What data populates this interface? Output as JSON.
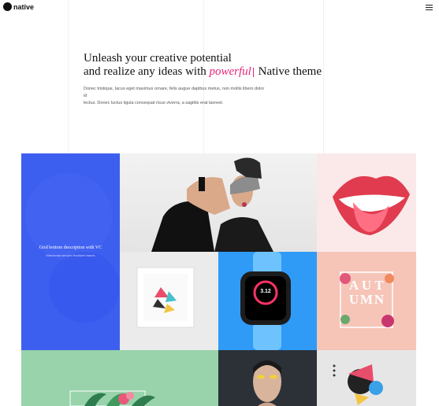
{
  "header": {
    "logo_text": "native",
    "menu_icon": "hamburger-menu-icon"
  },
  "hero": {
    "line1": "Unleash your creative potential",
    "line2_pre": "and realize any ideas with ",
    "line2_accent": "powerful",
    "line2_post": " Native theme",
    "desc_line1": "Donec tristique, lacus eget maximus ornare, felis augue dapibus metus, non mollis libero dolor id",
    "desc_line2": "lectus. Donec luctus ligula consequat risus viverra, a sagittis erat laoreet."
  },
  "grid": {
    "blue_tile": {
      "title": "Grid bottom description with VC",
      "subtitle": "Maecenas semper tincidunt mauris"
    },
    "autumn_letters": [
      "A",
      "U",
      "T",
      "U",
      "M",
      "N"
    ],
    "watch_value": "3.12"
  },
  "colors": {
    "accent": "#e8237b",
    "blue_tile": "#3d5ff0",
    "watch_bg": "#2f9bf7",
    "autumn_bg": "#f6c5b8",
    "green_bg": "#98d3ab"
  }
}
